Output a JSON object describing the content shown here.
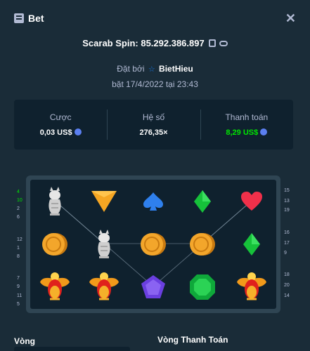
{
  "header": {
    "title": "Bet",
    "icon": "bet-ticket-icon",
    "close_icon": "close-icon"
  },
  "game": {
    "label": "Scarab Spin: 85.292.386.897",
    "copy_icon": "copy-icon",
    "link_icon": "link-icon"
  },
  "placed": {
    "prefix": "Đặt bởi",
    "user": "BietHieu",
    "user_icon": "star-icon",
    "time": "bặt 17/4/2022 tại 23:43"
  },
  "stats": {
    "bet_label": "Cược",
    "bet_value": "0,03 US$",
    "mult_label": "Hệ số",
    "mult_value": "276,35×",
    "payout_label": "Thanh toán",
    "payout_value": "8,29 US$",
    "payout_color": "#00e701"
  },
  "board": {
    "rows": [
      [
        "cat",
        "triangle",
        "spade",
        "diamond",
        "heart"
      ],
      [
        "coin",
        "cat",
        "coin",
        "coin",
        "diamond"
      ],
      [
        "scarab",
        "scarab",
        "pentagon",
        "octagon",
        "scarab"
      ]
    ],
    "left_numbers": [
      "4",
      "10",
      "2",
      "6",
      "12",
      "1",
      "8",
      "7",
      "9",
      "11",
      "5"
    ],
    "left_highlight": [
      "4",
      "10"
    ],
    "right_numbers": [
      "15",
      "13",
      "19",
      "16",
      "17",
      "9",
      "18",
      "20",
      "14"
    ]
  },
  "footer": {
    "left": "Vòng",
    "right": "Vòng Thanh Toán"
  }
}
